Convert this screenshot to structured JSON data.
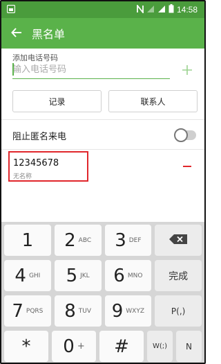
{
  "status_bar": {
    "time": "14:58"
  },
  "app_bar": {
    "title": "黑名单"
  },
  "add_number": {
    "label": "添加电话号码",
    "placeholder": "输入电话号码"
  },
  "buttons": {
    "log": "记录",
    "contacts": "联系人"
  },
  "anonymous": {
    "label": "阻止匿名来电",
    "enabled": false
  },
  "entries": [
    {
      "number": "12345678",
      "name": "无名称"
    }
  ],
  "keypad": {
    "row1": [
      {
        "digit": "1",
        "letters": ""
      },
      {
        "digit": "2",
        "letters": "ABC"
      },
      {
        "digit": "3",
        "letters": "DEF"
      }
    ],
    "row2": [
      {
        "digit": "4",
        "letters": "GHI"
      },
      {
        "digit": "5",
        "letters": "JKL"
      },
      {
        "digit": "6",
        "letters": "MNO"
      }
    ],
    "row3": [
      {
        "digit": "7",
        "letters": "PQRS"
      },
      {
        "digit": "8",
        "letters": "TUV"
      },
      {
        "digit": "9",
        "letters": "WXYZ"
      }
    ],
    "row4": [
      {
        "digit": "*",
        "letters": ""
      },
      {
        "digit": "0",
        "letters": "+"
      },
      {
        "digit": "#",
        "letters": ""
      }
    ],
    "done": "完成",
    "pause": "P(,)",
    "wait": "W(;)",
    "n": "N"
  }
}
